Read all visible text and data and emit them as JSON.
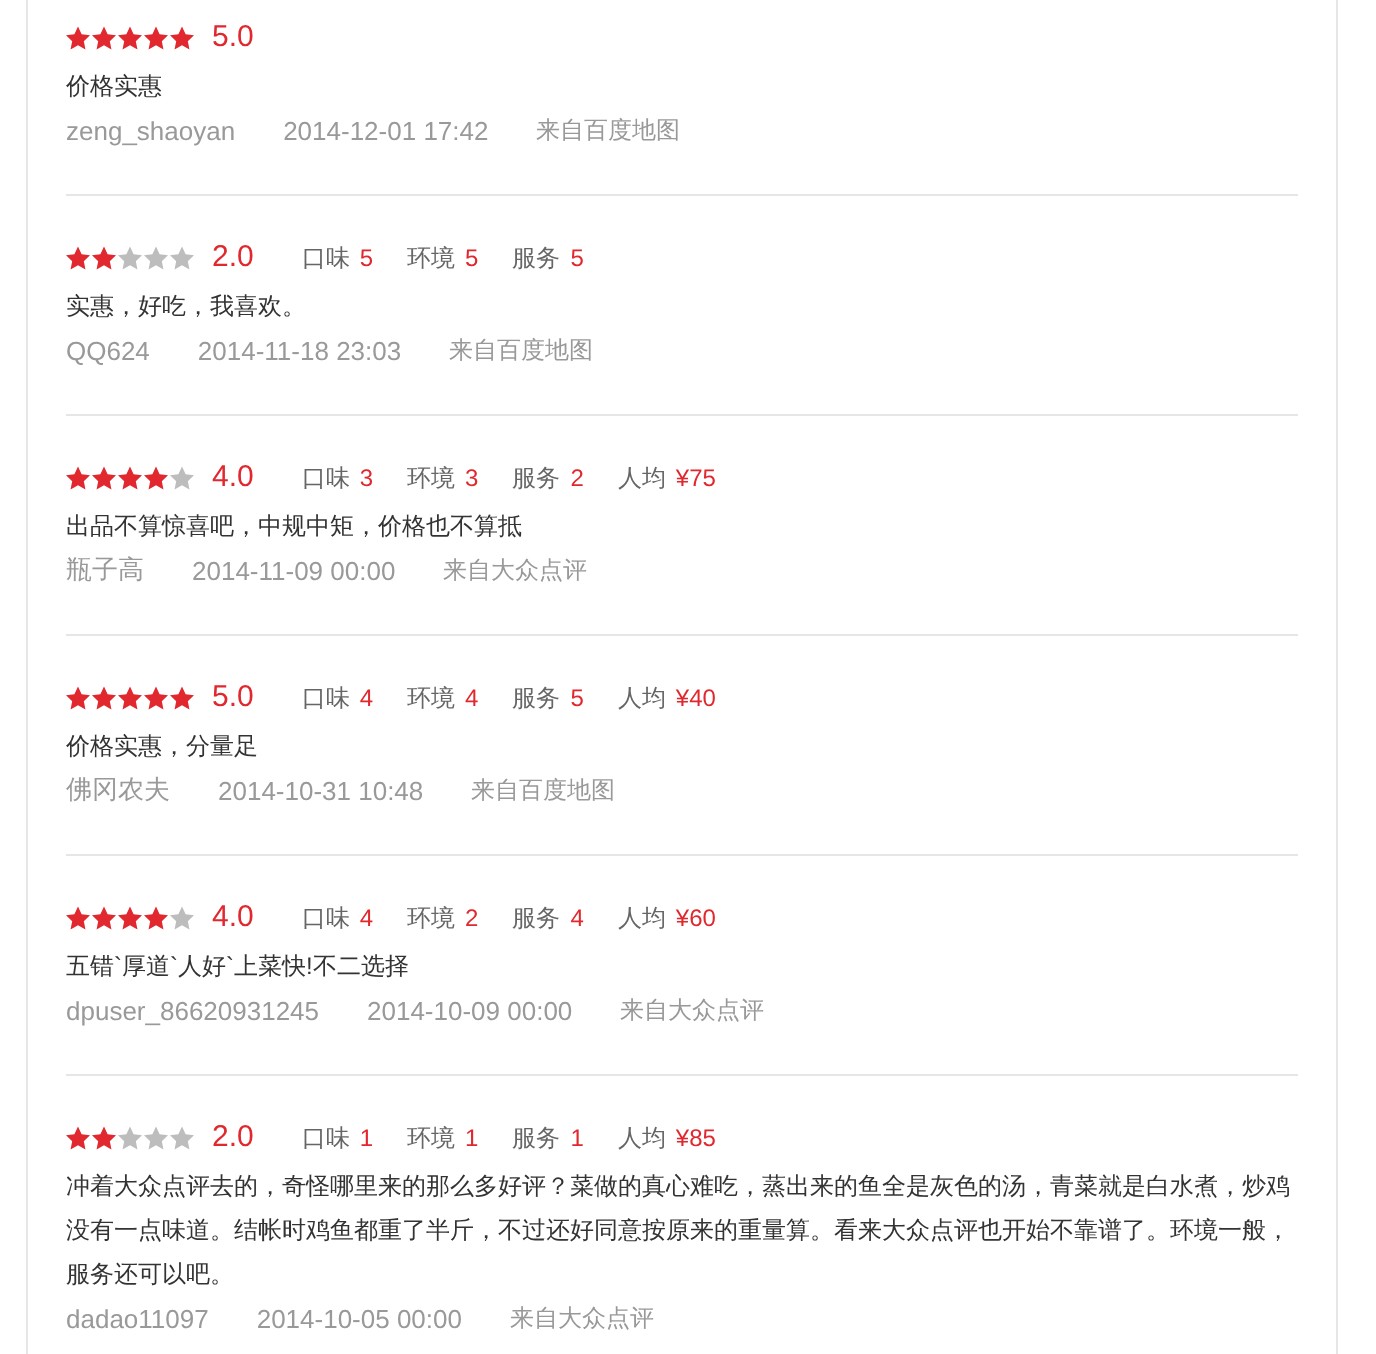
{
  "reviews": [
    {
      "stars": 5,
      "score": "5.0",
      "text": "价格实惠",
      "user": "zeng_shaoyan",
      "date": "2014-12-01 17:42",
      "source": "来自百度地图"
    },
    {
      "stars": 2,
      "score": "2.0",
      "details": [
        {
          "label": "口味",
          "value": "5"
        },
        {
          "label": "环境",
          "value": "5"
        },
        {
          "label": "服务",
          "value": "5"
        }
      ],
      "text": "实惠，好吃，我喜欢。",
      "user": "QQ624",
      "date": "2014-11-18 23:03",
      "source": "来自百度地图"
    },
    {
      "stars": 4,
      "score": "4.0",
      "details": [
        {
          "label": "口味",
          "value": "3"
        },
        {
          "label": "环境",
          "value": "3"
        },
        {
          "label": "服务",
          "value": "2"
        },
        {
          "label": "人均",
          "value": "¥75"
        }
      ],
      "text": "出品不算惊喜吧，中规中矩，价格也不算抵",
      "user": "瓶子高",
      "date": "2014-11-09 00:00",
      "source": "来自大众点评"
    },
    {
      "stars": 5,
      "score": "5.0",
      "details": [
        {
          "label": "口味",
          "value": "4"
        },
        {
          "label": "环境",
          "value": "4"
        },
        {
          "label": "服务",
          "value": "5"
        },
        {
          "label": "人均",
          "value": "¥40"
        }
      ],
      "text": "价格实惠，分量足",
      "user": "佛冈农夫",
      "date": "2014-10-31 10:48",
      "source": "来自百度地图"
    },
    {
      "stars": 4,
      "score": "4.0",
      "details": [
        {
          "label": "口味",
          "value": "4"
        },
        {
          "label": "环境",
          "value": "2"
        },
        {
          "label": "服务",
          "value": "4"
        },
        {
          "label": "人均",
          "value": "¥60"
        }
      ],
      "text": "五错`厚道`人好`上菜快!不二选择",
      "user": "dpuser_86620931245",
      "date": "2014-10-09 00:00",
      "source": "来自大众点评"
    },
    {
      "stars": 2,
      "score": "2.0",
      "details": [
        {
          "label": "口味",
          "value": "1"
        },
        {
          "label": "环境",
          "value": "1"
        },
        {
          "label": "服务",
          "value": "1"
        },
        {
          "label": "人均",
          "value": "¥85"
        }
      ],
      "text": "冲着大众点评去的，奇怪哪里来的那么多好评？菜做的真心难吃，蒸出来的鱼全是灰色的汤，青菜就是白水煮，炒鸡没有一点味道。结帐时鸡鱼都重了半斤，不过还好同意按原来的重量算。看来大众点评也开始不靠谱了。环境一般，服务还可以吧。",
      "user": "dadao11097",
      "date": "2014-10-05 00:00",
      "source": "来自大众点评"
    }
  ]
}
